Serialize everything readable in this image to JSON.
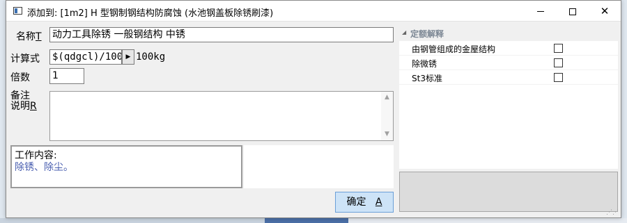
{
  "window": {
    "title": "添加到: [1m2] H 型钢制钢结构防腐蚀 (水池钢盖板除锈刷漆)",
    "minimize_label": "",
    "maximize_label": "",
    "close_label": "✕"
  },
  "form": {
    "name_label": "名称",
    "name_hotkey": "T",
    "name_value": "动力工具除锈 一般钢结构 中锈",
    "formula_label": "计算式",
    "formula_value": "$(qdgcl)/100",
    "formula_btn": "▶",
    "unit": "100kg",
    "multiplier_label": "倍数",
    "multiplier_value": "1",
    "remark_label": "备注",
    "desc_label": "说明",
    "desc_hotkey": "R",
    "remark_value": ""
  },
  "work": {
    "title": "工作内容:",
    "content": "除锈、除尘。"
  },
  "ok_button": {
    "label": "确定",
    "hotkey": "A"
  },
  "panel": {
    "header": "定额解释",
    "items": [
      {
        "label": "由钢管组成的金屋结构",
        "checked": false
      },
      {
        "label": "除微锈",
        "checked": false
      },
      {
        "label": "St3标准",
        "checked": false
      }
    ]
  }
}
